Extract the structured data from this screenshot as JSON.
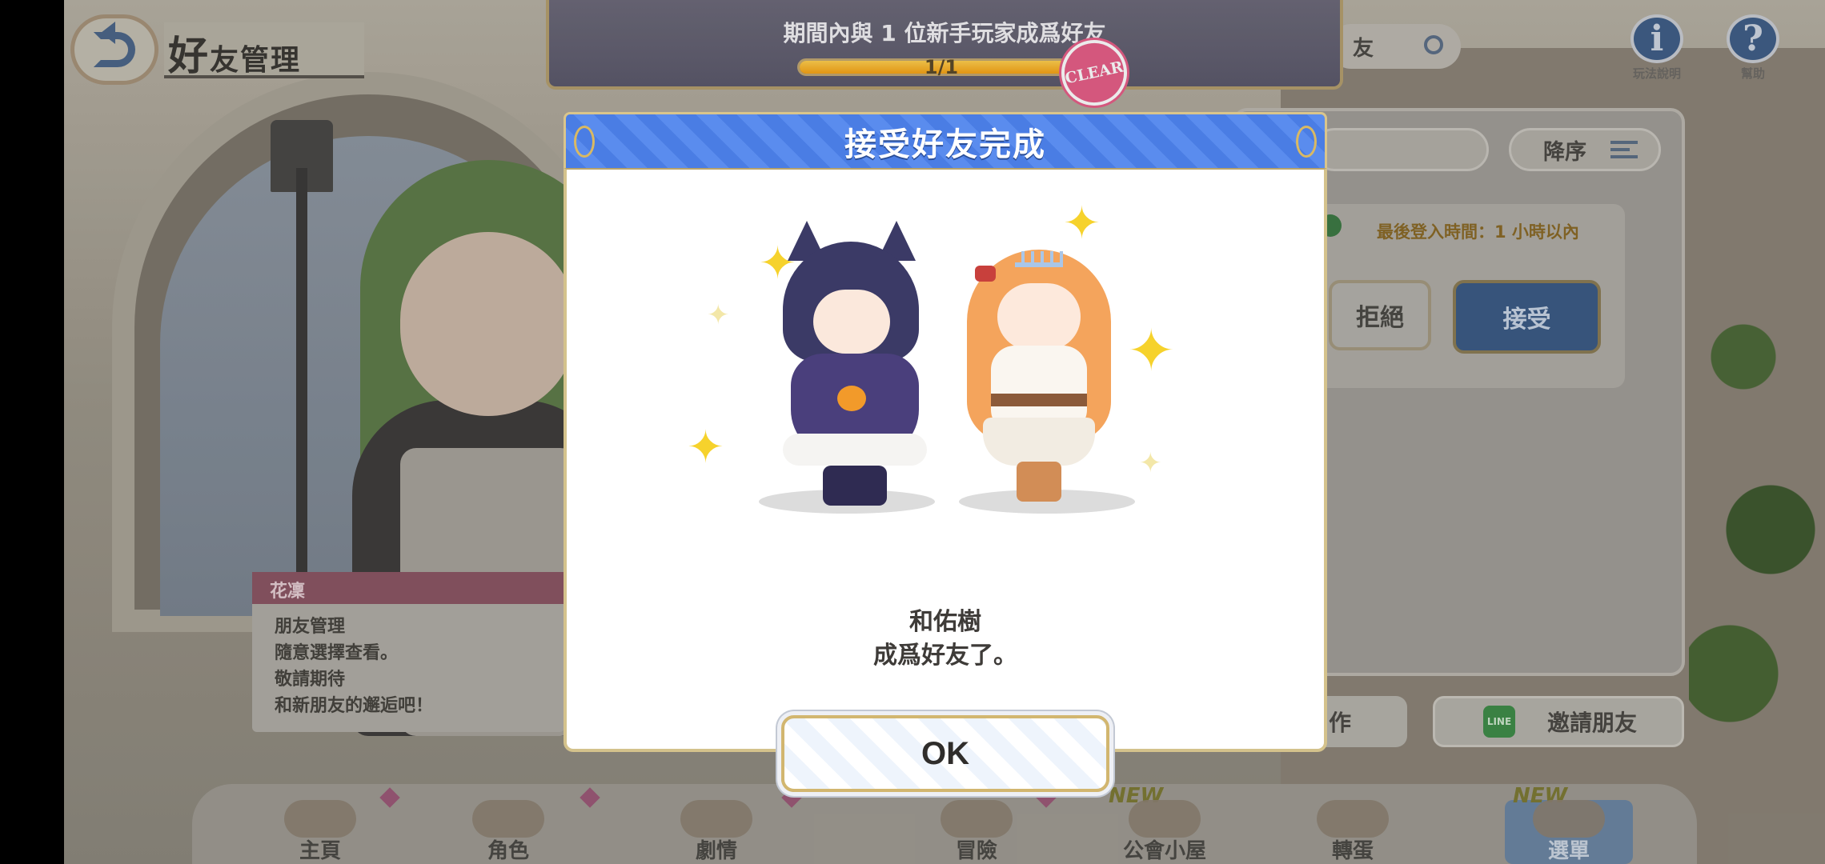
{
  "header": {
    "title_big": "好",
    "title_rest": "友管理"
  },
  "top_icons": {
    "info_caption": "玩法說明",
    "help_caption": "幫助",
    "info_glyph": "i",
    "help_glyph": "?"
  },
  "search": {
    "label": "友"
  },
  "mission_banner": {
    "text": "期間內與 1 位新手玩家成爲好友",
    "progress_label": "1/1",
    "progress_fraction": 1.0,
    "clear_stamp": "CLEAR"
  },
  "friend_panel": {
    "sort_label": "降序",
    "last_login": "最後登入時間：1 小時以內",
    "reject_label": "拒絕",
    "accept_label": "接受",
    "action_label": "作",
    "invite_label": "邀請朋友",
    "line_icon_text": "LINE"
  },
  "speech": {
    "speaker": "花凜",
    "lines": [
      "朋友管理",
      "隨意選擇查看。",
      "敬請期待",
      "和新朋友的邂逅吧！"
    ]
  },
  "bottom_nav": {
    "items": [
      {
        "label": "主頁",
        "new": ""
      },
      {
        "label": "角色",
        "new": ""
      },
      {
        "label": "劇情",
        "new": ""
      },
      {
        "label": "冒險",
        "new": ""
      },
      {
        "label": "公會小屋",
        "new": "NEW"
      },
      {
        "label": "轉蛋",
        "new": ""
      },
      {
        "label": "選單",
        "new": "NEW"
      }
    ]
  },
  "modal": {
    "title": "接受好友完成",
    "friend_name": "和佑樹",
    "message": "成爲好友了。",
    "ok_label": "OK"
  },
  "colors": {
    "modal_header": "#4a7de4",
    "modal_border": "#d9c58c",
    "progress_fill": "#f5a216",
    "clear_stamp": "#e65f88"
  }
}
